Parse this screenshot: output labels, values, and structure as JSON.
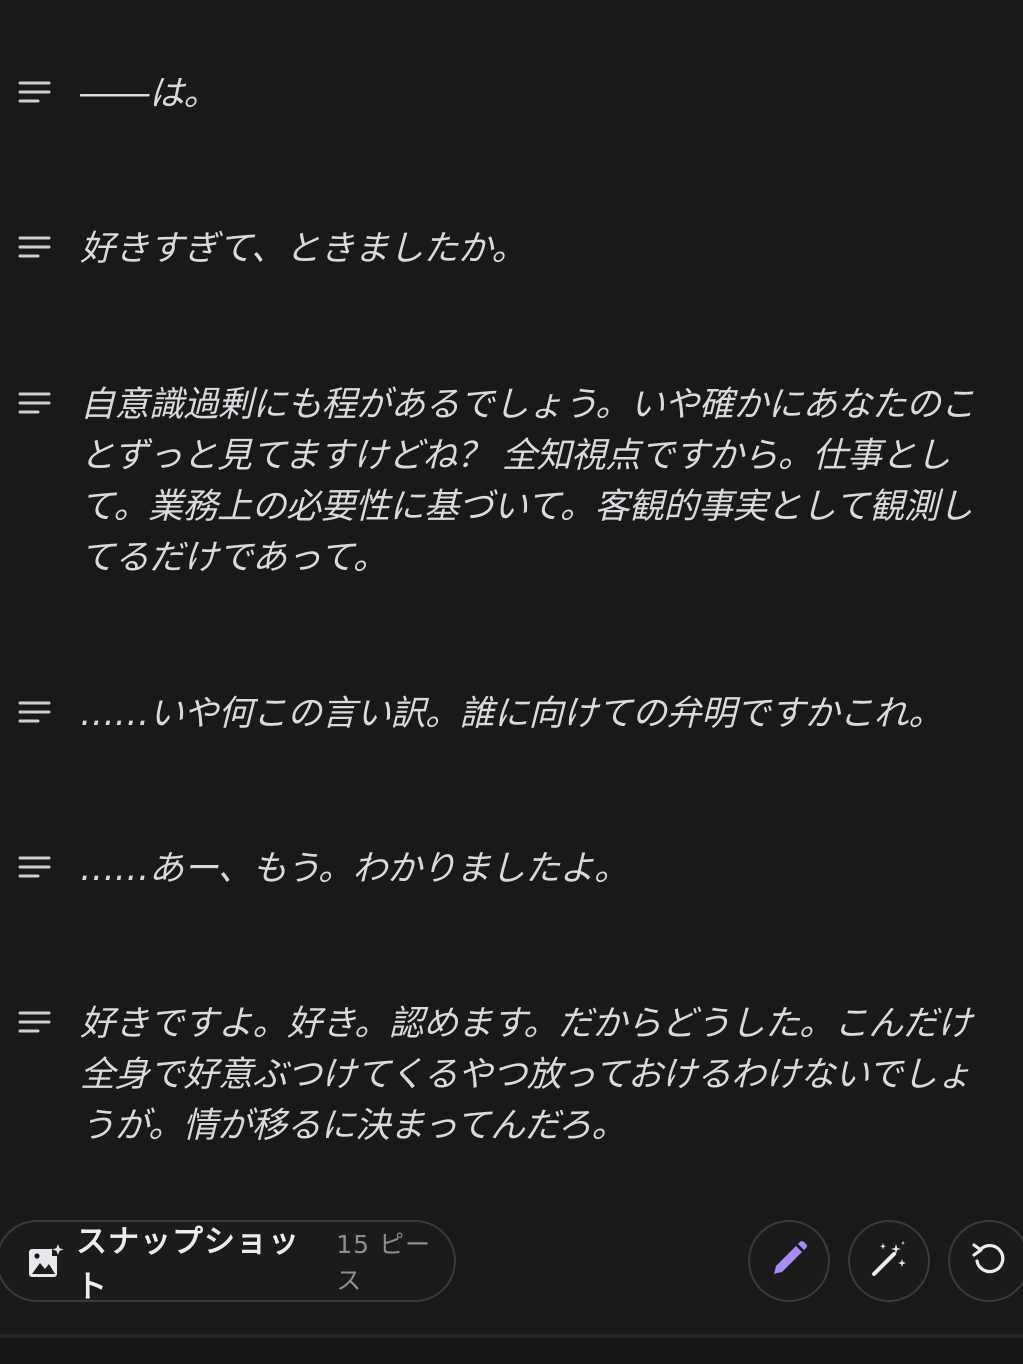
{
  "paragraphs": [
    {
      "text": "――は。"
    },
    {
      "text": "好きすぎて、ときましたか。"
    },
    {
      "text": "自意識過剰にも程があるでしょう。いや確かにあなたのことずっと見てますけどね？ 全知視点ですから。仕事として。業務上の必要性に基づいて。客観的事実として観測してるだけであって。"
    },
    {
      "text": "……いや何この言い訳。誰に向けての弁明ですかこれ。"
    },
    {
      "text": "……あー、もう。わかりましたよ。"
    },
    {
      "text": "好きですよ。好き。認めます。だからどうした。こんだけ全身で好意ぶつけてくるやつ放っておけるわけないでしょうが。情が移るに決まってんだろ。"
    }
  ],
  "toolbar": {
    "snapshot_label": "スナップショット",
    "snapshot_count": "15 ピース",
    "snapshot_icon": "image-sparkle-icon",
    "edit_icon": "pencil-icon",
    "magic_icon": "magic-wand-icon",
    "undo_icon": "undo-icon",
    "accent_color": "#a78bfa"
  }
}
